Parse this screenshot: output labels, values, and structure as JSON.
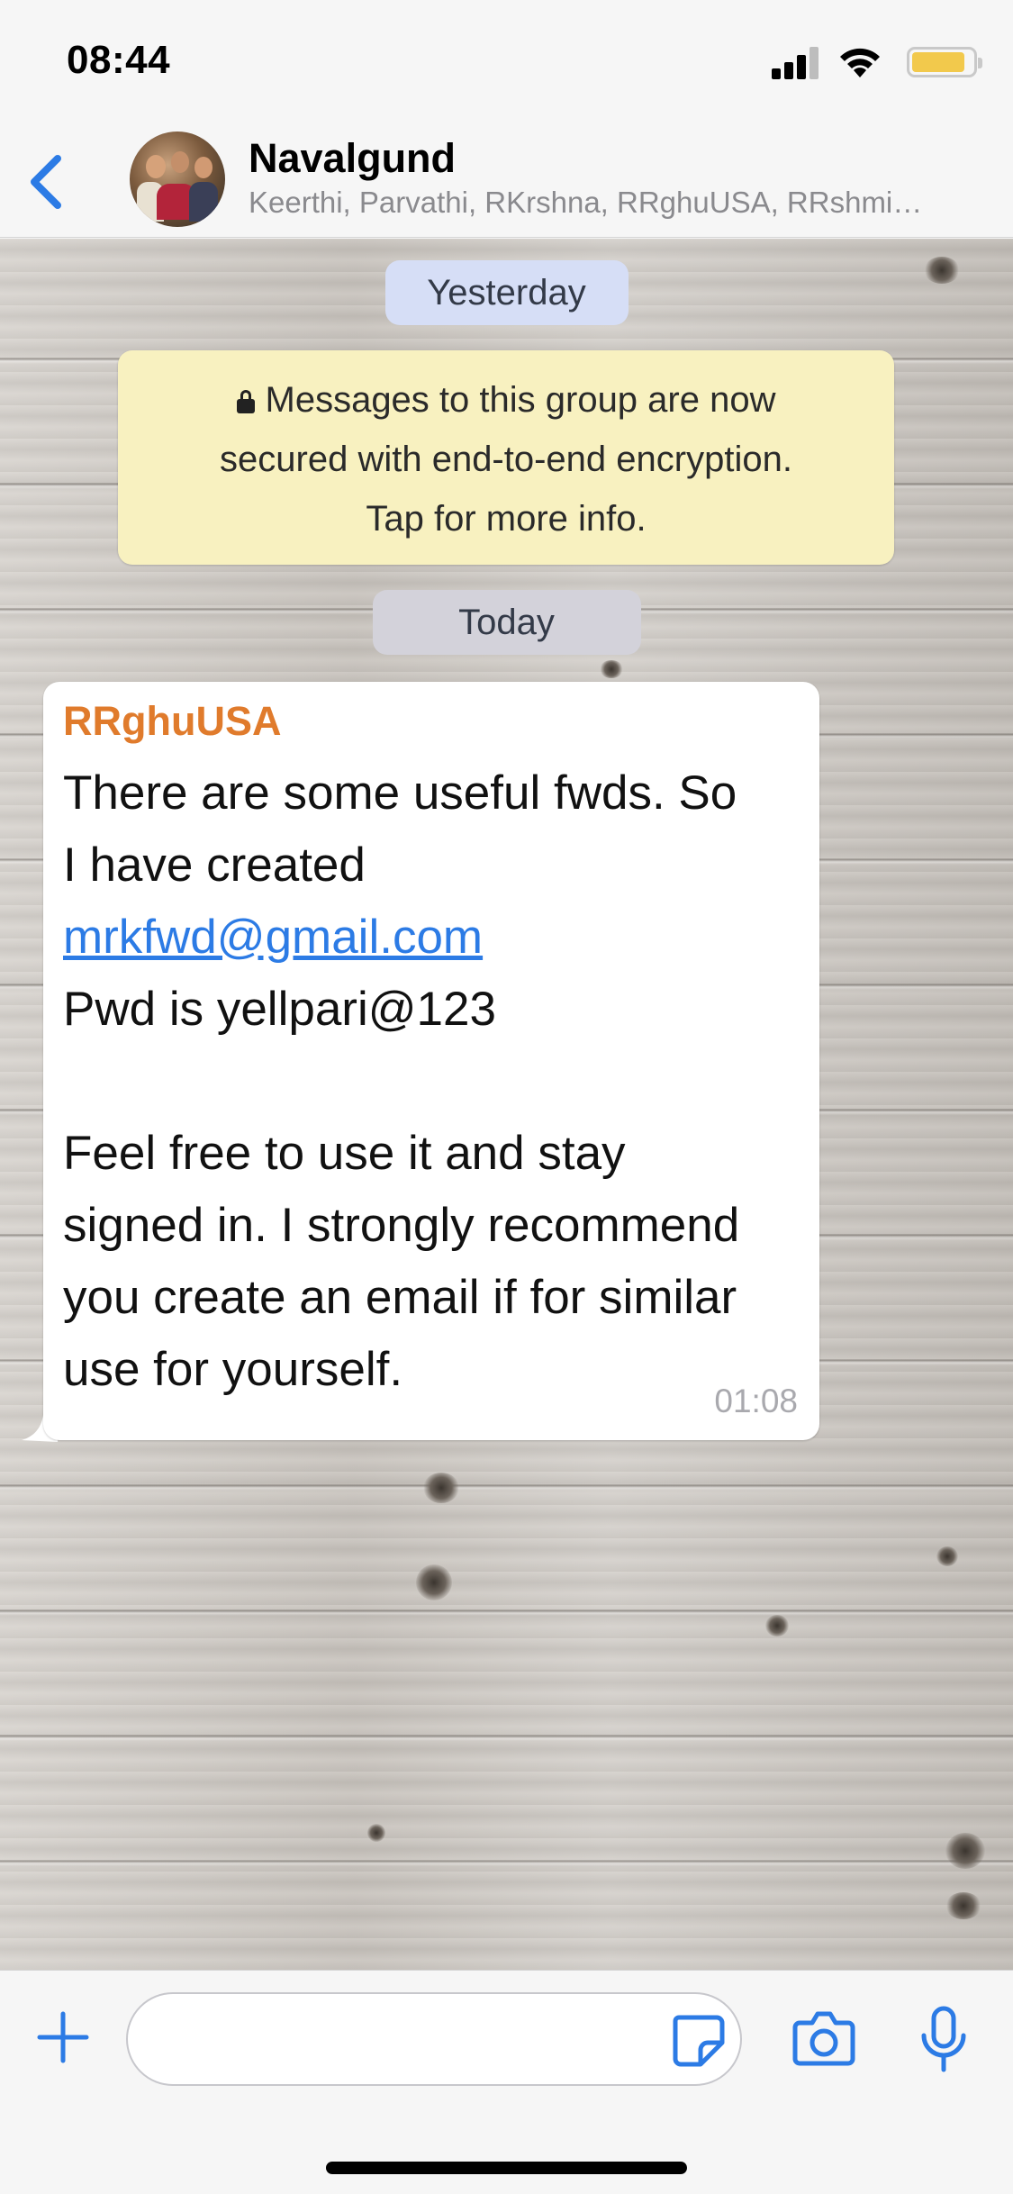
{
  "status_bar": {
    "time": "08:44",
    "icons": [
      "signal-icon",
      "wifi-icon",
      "battery-icon"
    ],
    "battery_color": "#f2c94c"
  },
  "header": {
    "back_icon": "chevron-left-icon",
    "group_name": "Navalgund",
    "members": "Keerthi, Parvathi, RKrshna, RRghuUSA, RRshmi…",
    "accent_color": "#2c7be5"
  },
  "chat": {
    "date_yesterday": "Yesterday",
    "encryption_notice": {
      "line1": "Messages to this group are now",
      "line2": "secured with end-to-end encryption.",
      "line3": "Tap for more info.",
      "icon": "lock-icon"
    },
    "date_today": "Today",
    "message": {
      "sender": "RRghuUSA",
      "sender_color": "#e07b2c",
      "lines": [
        "There are some useful fwds. So",
        "I have created",
        "mrkfwd@gmail.com",
        "Pwd is yellpari@123",
        "",
        "Feel free to use it and stay",
        "signed in. I strongly recommend",
        "you create an email if for similar",
        "use for yourself."
      ],
      "link": "mrkfwd@gmail.com",
      "time": "01:08"
    }
  },
  "input_bar": {
    "plus_icon": "plus-icon",
    "message_placeholder": "",
    "sticker_icon": "sticker-icon",
    "camera_icon": "camera-icon",
    "mic_icon": "microphone-icon"
  }
}
